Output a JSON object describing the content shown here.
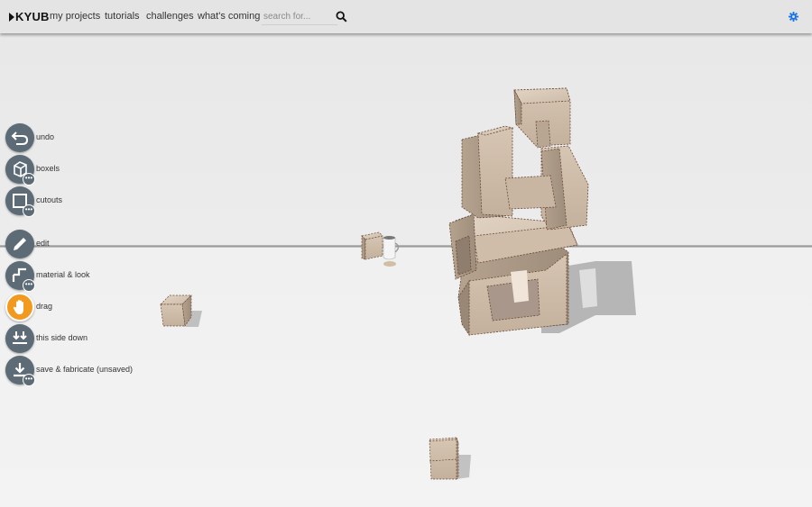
{
  "header": {
    "logo_text": "KYUB",
    "nav": [
      {
        "label": "my projects"
      },
      {
        "label": "tutorials"
      },
      {
        "label": "challenges"
      },
      {
        "label": "what's coming"
      }
    ],
    "search_placeholder": "search for..."
  },
  "toolbar": {
    "items": [
      {
        "label": "undo",
        "icon": "undo-icon",
        "has_more": false,
        "active": false
      },
      {
        "label": "boxels",
        "icon": "cube-icon",
        "has_more": true,
        "active": false
      },
      {
        "label": "cutouts",
        "icon": "square-icon",
        "has_more": true,
        "active": false
      },
      {
        "label": "edit",
        "icon": "pencil-icon",
        "has_more": false,
        "active": false
      },
      {
        "label": "material & look",
        "icon": "material-icon",
        "has_more": true,
        "active": false
      },
      {
        "label": "drag",
        "icon": "hand-icon",
        "has_more": false,
        "active": true
      },
      {
        "label": "this side down",
        "icon": "side-down-icon",
        "has_more": false,
        "active": false
      },
      {
        "label": "save & fabricate (unsaved)",
        "icon": "download-icon",
        "has_more": true,
        "active": false
      }
    ]
  },
  "colors": {
    "tool_button": "#5c6b76",
    "active_tool": "#f29a1f",
    "wood_light": "#d8c7b5",
    "wood_dark": "#a99887",
    "settings_gear": "#1a73e8"
  }
}
